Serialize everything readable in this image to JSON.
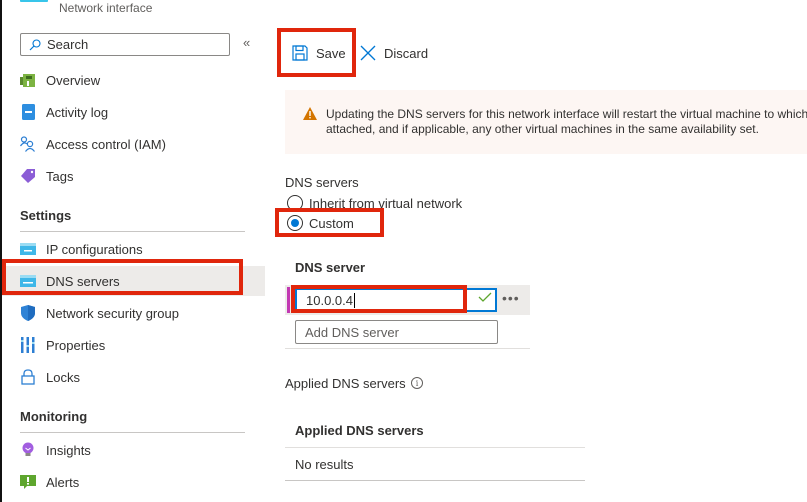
{
  "header": {
    "resource_type": "Network interface"
  },
  "sidebar": {
    "search_placeholder": "Search",
    "collapse_label": "«",
    "items": [
      {
        "label": "Overview",
        "icon": "overview-icon"
      },
      {
        "label": "Activity log",
        "icon": "activity-log-icon"
      },
      {
        "label": "Access control (IAM)",
        "icon": "iam-icon"
      },
      {
        "label": "Tags",
        "icon": "tag-icon"
      }
    ],
    "settings_heading": "Settings",
    "settings_items": [
      {
        "label": "IP configurations",
        "icon": "ip-config-icon"
      },
      {
        "label": "DNS servers",
        "icon": "dns-icon",
        "selected": true
      },
      {
        "label": "Network security group",
        "icon": "shield-icon"
      },
      {
        "label": "Properties",
        "icon": "properties-icon"
      },
      {
        "label": "Locks",
        "icon": "lock-icon"
      }
    ],
    "monitoring_heading": "Monitoring",
    "monitoring_items": [
      {
        "label": "Insights",
        "icon": "insights-icon"
      },
      {
        "label": "Alerts",
        "icon": "alerts-icon"
      }
    ]
  },
  "toolbar": {
    "save_label": "Save",
    "discard_label": "Discard"
  },
  "warning": {
    "line1": "Updating the DNS servers for this network interface will restart the virtual machine to which",
    "line2": "attached, and if applicable, any other virtual machines in the same availability set."
  },
  "dns": {
    "section_label": "DNS servers",
    "options": [
      {
        "label": "Inherit from virtual network",
        "checked": false
      },
      {
        "label": "Custom",
        "checked": true
      }
    ],
    "column_header": "DNS server",
    "servers": [
      "10.0.0.4"
    ],
    "add_placeholder": "Add DNS server",
    "more_label": "•••"
  },
  "applied": {
    "label": "Applied DNS servers",
    "table_header": "Applied DNS servers",
    "empty_text": "No results"
  },
  "colors": {
    "accent": "#0078d4",
    "highlight": "#e0260c",
    "warning_bg": "#fdf6f3",
    "warning_icon": "#d47500"
  }
}
